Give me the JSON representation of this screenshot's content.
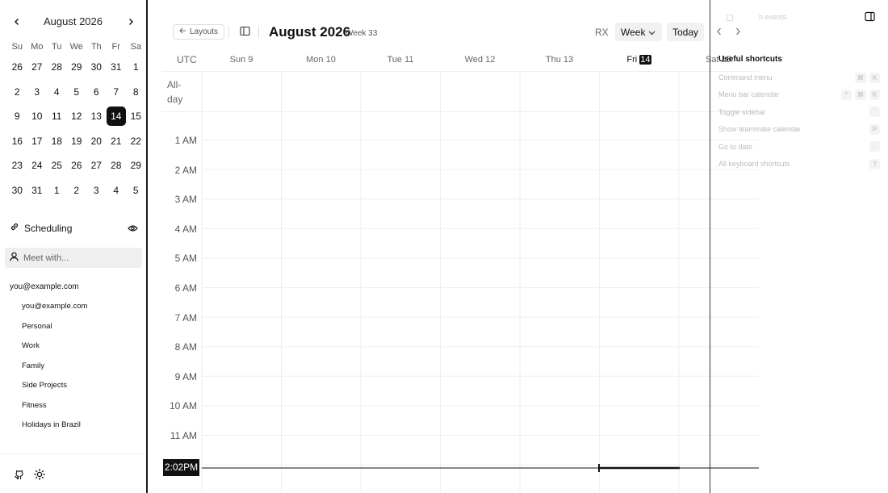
{
  "mini_calendar": {
    "title": "August 2026",
    "dow": [
      "Su",
      "Mo",
      "Tu",
      "We",
      "Th",
      "Fr",
      "Sa"
    ],
    "weeks": [
      [
        "26",
        "27",
        "28",
        "29",
        "30",
        "31",
        "1"
      ],
      [
        "2",
        "3",
        "4",
        "5",
        "6",
        "7",
        "8"
      ],
      [
        "9",
        "10",
        "11",
        "12",
        "13",
        "14",
        "15"
      ],
      [
        "16",
        "17",
        "18",
        "19",
        "20",
        "21",
        "22"
      ],
      [
        "23",
        "24",
        "25",
        "26",
        "27",
        "28",
        "29"
      ],
      [
        "30",
        "31",
        "1",
        "2",
        "3",
        "4",
        "5"
      ]
    ],
    "today": "14"
  },
  "scheduling": {
    "label": "Scheduling",
    "meet_placeholder": "Meet with..."
  },
  "account": {
    "email": "you@example.com",
    "calendars": [
      "you@example.com",
      "Personal",
      "Work",
      "Family",
      "Side Projects",
      "Fitness",
      "Holidays in Brazil"
    ]
  },
  "header": {
    "layouts_label": "Layouts",
    "title": "August 2026",
    "week": "Week 33",
    "user_initials": "RX",
    "view": "Week",
    "today_label": "Today"
  },
  "grid": {
    "timezone": "UTC",
    "allday_label": "All-\nday",
    "days": [
      {
        "name": "Sun",
        "num": "9"
      },
      {
        "name": "Mon",
        "num": "10"
      },
      {
        "name": "Tue",
        "num": "11"
      },
      {
        "name": "Wed",
        "num": "12"
      },
      {
        "name": "Thu",
        "num": "13"
      },
      {
        "name": "Fri",
        "num": "14"
      },
      {
        "name": "Sat",
        "num": "15"
      }
    ],
    "hours": [
      "1 AM",
      "2 AM",
      "3 AM",
      "4 AM",
      "5 AM",
      "6 AM",
      "7 AM",
      "8 AM",
      "9 AM",
      "10 AM",
      "11 AM"
    ],
    "now_label": "2:02PM"
  },
  "shortcuts_panel": {
    "search_placeholder": "h events",
    "title": "Useful shortcuts",
    "items": [
      {
        "label": "Command menu",
        "keys": [
          "⌘",
          "K"
        ]
      },
      {
        "label": "Menu bar calendar",
        "keys": [
          "⌃",
          "⌘",
          "K"
        ]
      },
      {
        "label": "Toggle sidebar",
        "keys": [
          "`"
        ]
      },
      {
        "label": "Show teammate calendar",
        "keys": [
          "P"
        ]
      },
      {
        "label": "Go to date",
        "keys": [
          "."
        ]
      },
      {
        "label": "All keyboard shortcuts",
        "keys": [
          "?"
        ]
      }
    ]
  },
  "colors": {
    "accent": "#111111",
    "muted": "#666666",
    "grid_line": "#eeeeee"
  }
}
